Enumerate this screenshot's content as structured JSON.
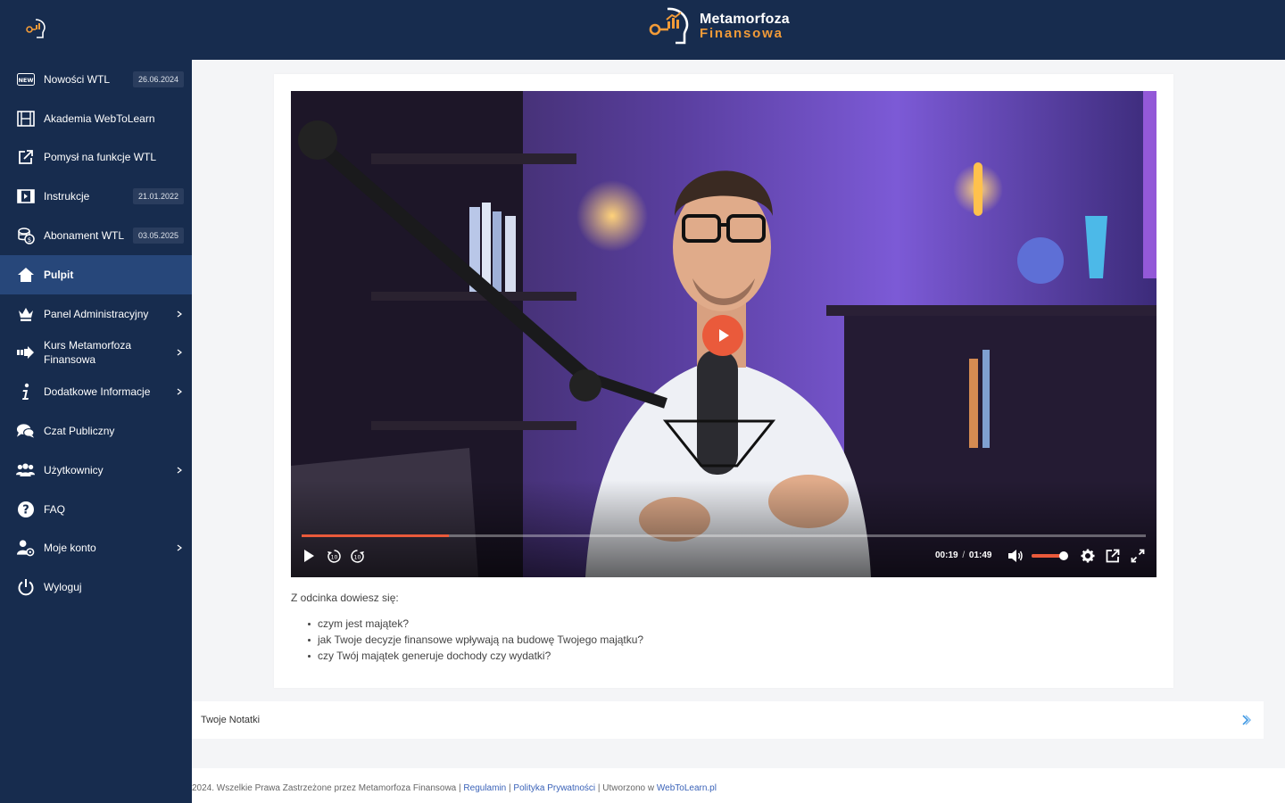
{
  "brand": {
    "line1": "Metamorfoza",
    "line2": "Finansowa"
  },
  "colors": {
    "navy": "#172c4e",
    "active": "#27477a",
    "accent": "#ea5a3b",
    "brand_orange": "#f29b38"
  },
  "sidebar": {
    "items": [
      {
        "label": "Nowości WTL",
        "icon": "new-badge-icon",
        "date": "26.06.2024"
      },
      {
        "label": "Akademia WebToLearn",
        "icon": "film-icon"
      },
      {
        "label": "Pomysł na funkcje WTL",
        "icon": "external-edit-icon"
      },
      {
        "label": "Instrukcje",
        "icon": "video-icon",
        "date": "21.01.2022"
      },
      {
        "label": "Abonament WTL",
        "icon": "coins-icon",
        "date": "03.05.2025"
      },
      {
        "label": "Pulpit",
        "icon": "home-icon",
        "active": true
      },
      {
        "label": "Panel Administracyjny",
        "icon": "crown-icon",
        "chevron": true
      },
      {
        "label": "Kurs Metamorfoza Finansowa",
        "icon": "arrow-right-icon",
        "chevron": true
      },
      {
        "label": "Dodatkowe Informacje",
        "icon": "info-icon",
        "chevron": true
      },
      {
        "label": "Czat Publiczny",
        "icon": "chat-icon"
      },
      {
        "label": "Użytkownicy",
        "icon": "users-icon",
        "chevron": true
      },
      {
        "label": "FAQ",
        "icon": "question-icon"
      },
      {
        "label": "Moje konto",
        "icon": "user-gear-icon",
        "chevron": true
      },
      {
        "label": "Wyloguj",
        "icon": "power-icon"
      }
    ]
  },
  "video": {
    "current_time": "00:19",
    "time_separator": "/",
    "duration": "01:49",
    "progress_fraction": 0.174,
    "volume_fraction": 0.9
  },
  "description": {
    "intro": "Z odcinka dowiesz się:",
    "bullets": [
      "czym jest majątek?",
      "jak Twoje decyzje finansowe wpływają na budowę Twojego majątku?",
      "czy Twój majątek generuje dochody czy wydatki?"
    ]
  },
  "notes": {
    "label": "Twoje Notatki"
  },
  "footer": {
    "copyright": "2024. Wszelkie Prawa Zastrzeżone przez Metamorfoza Finansowa",
    "sep": "|",
    "regulamin": "Regulamin",
    "privacy": "Polityka Prywatności",
    "created": "Utworzono w",
    "created_link": "WebToLearn.pl"
  }
}
